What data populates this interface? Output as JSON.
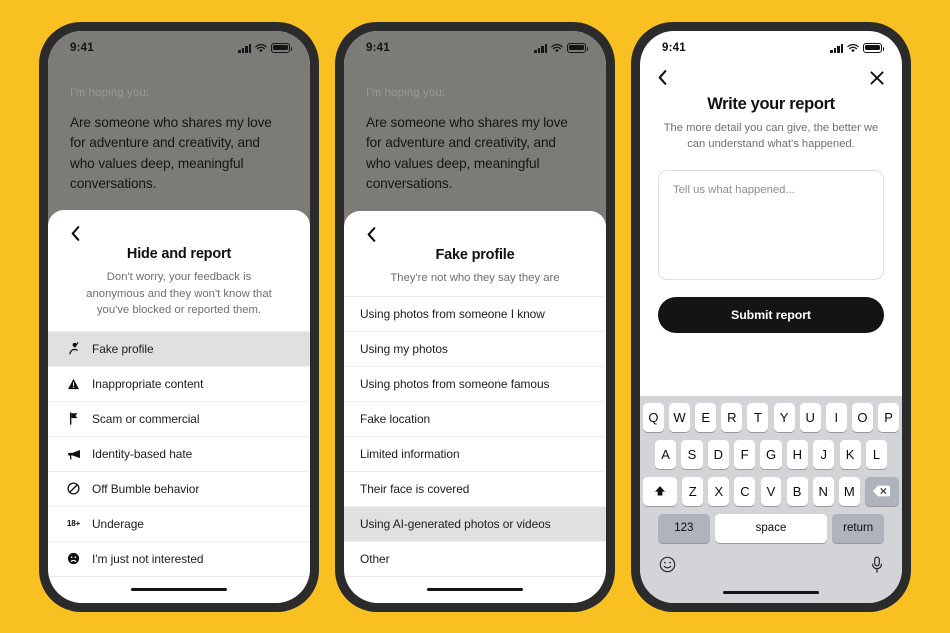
{
  "background_color": "#f9c022",
  "frame_color": "#2b2b2b",
  "status_bar": {
    "time": "9:41",
    "signal_icon": "cellular-bars-icon",
    "wifi_icon": "wifi-icon",
    "battery_icon": "battery-full-icon"
  },
  "profile_preview": {
    "kicker": "I'm hoping you:",
    "body": "Are someone who shares my love for adventure and creativity, and who values deep, meaningful conversations.",
    "badge_icon": "chat-bubble-icon"
  },
  "phone1": {
    "back_icon": "chevron-left-icon",
    "title": "Hide and report",
    "subtitle": "Don't worry, your feedback is anonymous and they won't know that you've blocked or reported them.",
    "options": [
      {
        "label": "Fake profile",
        "icon": "fake-profile-icon",
        "selected": true
      },
      {
        "label": "Inappropriate content",
        "icon": "warning-triangle-icon",
        "selected": false
      },
      {
        "label": "Scam or commercial",
        "icon": "flag-icon",
        "selected": false
      },
      {
        "label": "Identity-based hate",
        "icon": "megaphone-icon",
        "selected": false
      },
      {
        "label": "Off Bumble behavior",
        "icon": "prohibited-icon",
        "selected": false
      },
      {
        "label": "Underage",
        "icon": "18-plus-icon",
        "selected": false
      },
      {
        "label": "I'm just not interested",
        "icon": "frowning-face-icon",
        "selected": false
      }
    ]
  },
  "phone2": {
    "back_icon": "chevron-left-icon",
    "title": "Fake profile",
    "subtitle": "They're not who they say they are",
    "options": [
      {
        "label": "Using photos from someone I know",
        "selected": false
      },
      {
        "label": "Using my photos",
        "selected": false
      },
      {
        "label": "Using photos from someone famous",
        "selected": false
      },
      {
        "label": "Fake location",
        "selected": false
      },
      {
        "label": "Limited information",
        "selected": false
      },
      {
        "label": "Their face is covered",
        "selected": false
      },
      {
        "label": "Using AI-generated photos or videos",
        "selected": true
      },
      {
        "label": "Other",
        "selected": false
      }
    ]
  },
  "phone3": {
    "back_icon": "chevron-left-icon",
    "close_icon": "close-x-icon",
    "title": "Write your report",
    "subtitle": "The more detail you can give, the better we can understand what's happened.",
    "textarea_placeholder": "Tell us what happened...",
    "textarea_value": "",
    "submit_label": "Submit report",
    "keyboard": {
      "row1": [
        "Q",
        "W",
        "E",
        "R",
        "T",
        "Y",
        "U",
        "I",
        "O",
        "P"
      ],
      "row2": [
        "A",
        "S",
        "D",
        "F",
        "G",
        "H",
        "J",
        "K",
        "L"
      ],
      "row3": [
        "Z",
        "X",
        "C",
        "V",
        "B",
        "N",
        "M"
      ],
      "shift_icon": "shift-up-icon",
      "backspace_icon": "backspace-delete-icon",
      "numbers_label": "123",
      "space_label": "space",
      "return_label": "return",
      "emoji_icon": "emoji-smiley-icon",
      "mic_icon": "microphone-icon"
    }
  }
}
